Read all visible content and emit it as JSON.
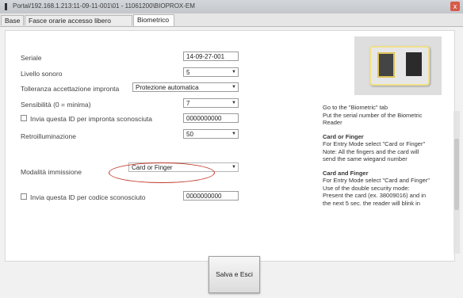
{
  "window": {
    "title": "Portal/192.168.1.213:11-09-11-001\\01 - 11061200\\BIOPROX-EM",
    "close_label": "x"
  },
  "tabs": [
    {
      "label": "Base",
      "active": false
    },
    {
      "label": "Fasce orarie accesso libero",
      "active": false
    },
    {
      "label": "Biometrico",
      "active": true
    }
  ],
  "form": {
    "seriale": {
      "label": "Seriale",
      "value": "14-09-27-001"
    },
    "livello": {
      "label": "Livello sonoro",
      "value": "5"
    },
    "tolleranza": {
      "label": "Tolleranza accettazione impronta",
      "value": "Protezione automatica"
    },
    "sensibilita": {
      "label": "Sensibilità (0 = minima)",
      "value": "7"
    },
    "invia_impronta": {
      "label": "Invia questa ID per impronta sconosciuta",
      "value": "0000000000",
      "checked": false
    },
    "retro": {
      "label": "Retroilluminazione",
      "value": "50"
    },
    "modalita": {
      "label": "Modalità immissione",
      "value": "Card or Finger"
    },
    "invia_codice": {
      "label": "Invia questa ID per codice sconosciuto",
      "value": "0000000000",
      "checked": false
    }
  },
  "help": {
    "intro": [
      "Go to the \"Biometric\" tab",
      "Put the serial number of the Biometric",
      "Reader"
    ],
    "sections": [
      {
        "heading": "Card or Finger",
        "lines": [
          "For Entry Mode select \"Card or Finger\"",
          "Note: All the fingers and the card will",
          "send the same wiegand number"
        ]
      },
      {
        "heading": "Card and Finger",
        "lines": [
          "For Entry Mode select \"Card and Finger\"",
          "Use of the double security mode:",
          "Present the card (ex. 38009016) and in",
          "the next 5 sec. the reader will blink in"
        ]
      }
    ]
  },
  "save_button": {
    "label": "Salva e Esci"
  },
  "colors": {
    "highlight_ellipse": "#c0392b"
  }
}
